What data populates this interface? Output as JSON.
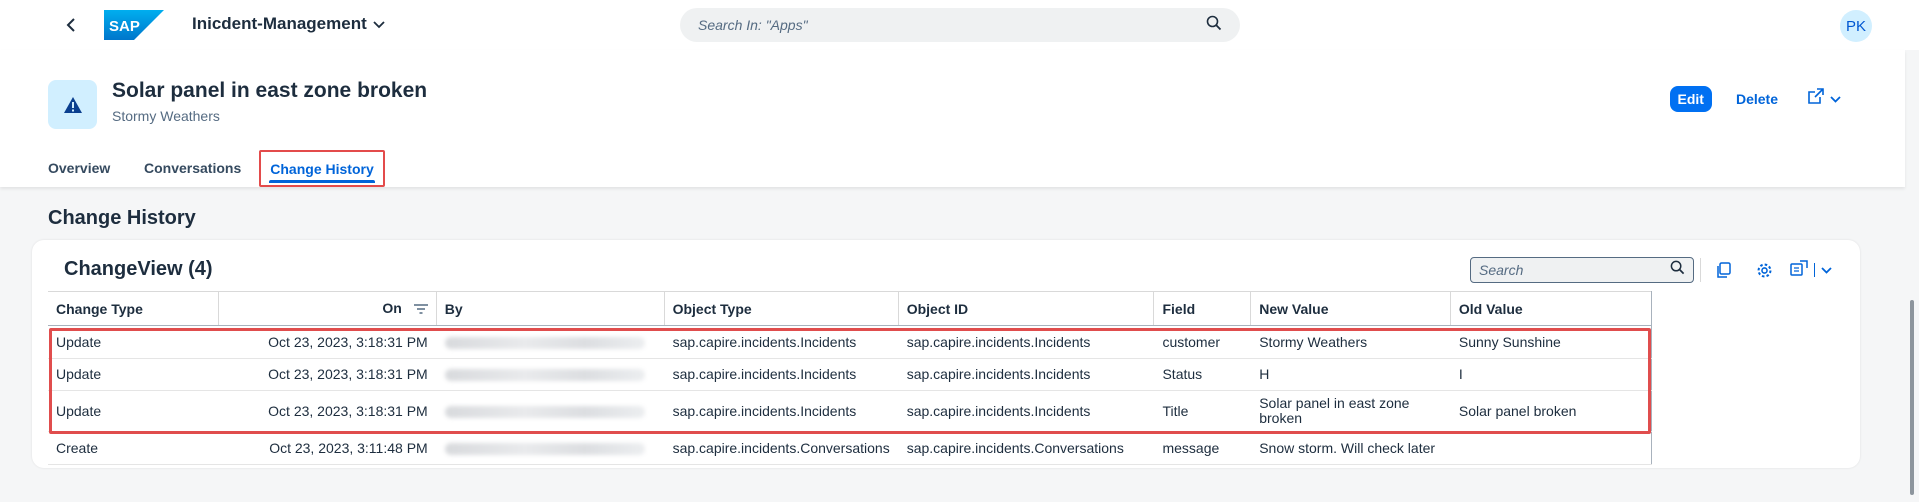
{
  "shell": {
    "app_title": "Inicdent-Management",
    "search_placeholder": "Search In: \"Apps\"",
    "avatar_initials": "PK",
    "logo_text": "SAP"
  },
  "header": {
    "title": "Solar panel in east zone broken",
    "subtitle": "Stormy Weathers",
    "edit_label": "Edit",
    "delete_label": "Delete"
  },
  "tabs": [
    {
      "label": "Overview"
    },
    {
      "label": "Conversations"
    },
    {
      "label": "Change History",
      "active": true
    }
  ],
  "section_title": "Change History",
  "table": {
    "title": "ChangeView (4)",
    "search_placeholder": "Search",
    "columns": [
      "Change Type",
      "On",
      "By",
      "Object Type",
      "Object ID",
      "Field",
      "New Value",
      "Old Value"
    ],
    "rows": [
      {
        "change_type": "Update",
        "on": "Oct 23, 2023, 3:18:31 PM",
        "object_type": "sap.capire.incidents.Incidents",
        "object_id": "sap.capire.incidents.Incidents",
        "field": "customer",
        "new_value": "Stormy Weathers",
        "old_value": "Sunny Sunshine"
      },
      {
        "change_type": "Update",
        "on": "Oct 23, 2023, 3:18:31 PM",
        "object_type": "sap.capire.incidents.Incidents",
        "object_id": "sap.capire.incidents.Incidents",
        "field": "Status",
        "new_value": "H",
        "old_value": "I"
      },
      {
        "change_type": "Update",
        "on": "Oct 23, 2023, 3:18:31 PM",
        "object_type": "sap.capire.incidents.Incidents",
        "object_id": "sap.capire.incidents.Incidents",
        "field": "Title",
        "new_value": "Solar panel in east zone broken",
        "old_value": "Solar panel broken"
      },
      {
        "change_type": "Create",
        "on": "Oct 23, 2023, 3:11:48 PM",
        "object_type": "sap.capire.incidents.Conversations",
        "object_id": "sap.capire.incidents.Conversations",
        "field": "message",
        "new_value": "Snow storm. Will check later",
        "old_value": ""
      }
    ]
  },
  "colors": {
    "accent": "#0070f2",
    "highlight": "#e04d4d",
    "text": "#1d2d3e"
  },
  "icons": [
    "back-icon",
    "sap-logo",
    "chevron-down-icon",
    "search-icon",
    "warning-icon",
    "share-icon",
    "sort-icon",
    "copy-icon",
    "settings-icon",
    "export-icon"
  ]
}
